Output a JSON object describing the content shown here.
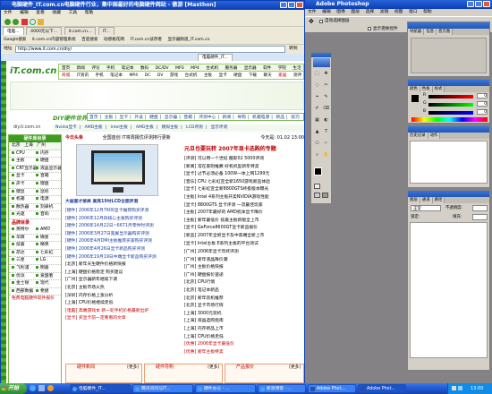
{
  "browser": {
    "title": "电脑硬件_IT.com.cn电脑硬件行业，集中国最好的电脑硬件网站 - 傲游 [Maxthon]",
    "menu": [
      "文件",
      "编辑",
      "查看",
      "收藏",
      "工具",
      "帮助"
    ],
    "tabs": [
      "电脑...",
      "4000元以下...",
      "it.com.cn...",
      "IT..."
    ],
    "links_bar": [
      "Google搜索",
      "it.com.cn内容管理系统",
      "百度搜索",
      "动感桃花网",
      "IT.com.cn读存者",
      "显示器频道_IT.com.cn"
    ],
    "address_label": "地址",
    "address": "http://www.it.com.cn/diy/",
    "go": "转到",
    "page_tabs": [
      "电脑硬件_IT..."
    ]
  },
  "site": {
    "logo": "iT.com.cn",
    "nav_row1": [
      "首页",
      "新闻",
      "评论",
      "手机",
      "笔记本",
      "数码",
      "DC/DV",
      "MP3",
      "MP4",
      "台式机",
      "服务器",
      "显示器",
      "软件",
      "学院",
      "生活",
      "北京",
      "上海",
      "广州",
      "深圳"
    ],
    "nav_row2": [
      "商城",
      "IT资讯",
      "手机",
      "笔记本",
      "MP4",
      "DC",
      "DV",
      "游戏",
      "台式机",
      "主板",
      "显卡",
      "硬盘",
      "下载",
      "聊天",
      "家居",
      "测评",
      "IT生活",
      "游戏",
      "图片",
      "论坛",
      "博客"
    ],
    "section_logo": "DIY硬件世界",
    "section_nav": [
      "首页",
      "主板",
      "显卡",
      "外设",
      "硬盘",
      "显示器",
      "音箱",
      "评测中心",
      "新闻",
      "导购",
      "机箱电源",
      "新品",
      "技巧"
    ],
    "sub_nav": [
      "Nvidia显卡",
      "AMD主板",
      "Intel主板",
      "AMD主板",
      "模拟主板",
      "LCD评测",
      "显示评测"
    ],
    "search_label": "diy.it.com.cn",
    "date_label": "今日头条",
    "date_text": "今天是: 01.02 13:00",
    "headline_top": "全国首创 IT将周报优评测排行更新"
  },
  "sidebar": {
    "title": "硬件库目录",
    "radio_options": [
      "北京",
      "上海",
      "广州"
    ],
    "pairs": [
      [
        "CPU",
        "内存"
      ],
      [
        "主板",
        "硬盘"
      ],
      [
        "CRT显示器",
        "液晶显示器"
      ],
      [
        "显卡",
        "音箱"
      ],
      [
        "声卡",
        "键盘"
      ],
      [
        "键鼠",
        "鼠标"
      ],
      [
        "机箱",
        "电源"
      ],
      [
        "散热器",
        "刻录机"
      ],
      [
        "光驱",
        "音响"
      ]
    ],
    "brand_title": "品牌目录",
    "brands": [
      [
        "英特尔",
        "AMD"
      ],
      [
        "华硕",
        "微星"
      ],
      [
        "技嘉",
        "精英"
      ],
      [
        "昂达",
        "七彩虹"
      ],
      [
        "三星",
        "LG"
      ],
      [
        "飞利浦",
        "明基"
      ],
      [
        "优派",
        "爱国者"
      ],
      [
        "金士顿",
        "现代"
      ],
      [
        "西部数据",
        "希捷"
      ]
    ],
    "footer_link": "免费电脑硬件软件报价"
  },
  "feature": {
    "title": "元旦也要玩转 2007年显卡选购的专题",
    "caption": "大画面才够爽 高亮19吋LCD全面评测",
    "items": [
      "[评测]  可以用一个世纪 酷影02 5000评测",
      "[新闻]  常在家则推薦 好机机型新年特卖",
      "[显卡]  过节必须必备 100W一体上网1299元",
      "[音乐]  CPU 七彩虹宣全新1650游戏新品体验",
      "[显卡]  七彩虹宣全新8800GTS终极版本曝光",
      "[主板]  Intel 4系列主板开卖NVIDIA游戏性能",
      "[显卡]  8800GTS 显卡评测 一流最佳玩家",
      "[主板]  2007年最好的 AMD机体显卡降价",
      "[主板]  新年最低价 技嘉主板新版全上市",
      "[显卡]  GeForce8600GT显卡新品报价",
      "[新品]  2007年全新显卡及中高端全新上市",
      "[显卡]  Intel主板 E系列主板的平台测试"
    ]
  },
  "news_left": [
    "[硬件]  2006年12月7600显卡推荐购买评测",
    "[硬件]  2006年12月四核心主板购买评测",
    "[硬件]  2006年14月22日~6671月零件时评测",
    "[硬件]  2006年3月27日宽屏显示器购买评测",
    "[硬件]  2006年4月DMI主板推荐买家购买评测",
    "[硬件]  2006年4月26日显卡新品购买评测",
    "[硬件]  2006年19月19日中端显卡新品购买评测",
    "[北京]  新年天生硬件价格新快报",
    "[上海]  硬盘价格稳定 购买建议",
    "[广州]  显示器新年继续下调",
    "[北京]  主板市场火热",
    "[深圳]  内存价格上涨分析",
    "[上海]  CPU价格继续走低"
  ],
  "news_left_red": [
    "[电脑]  高端游戏本 新一轮手机价格最新出炉",
    "[显卡]  买显卡前一定要看的文章"
  ],
  "news_right": [
    "[广州]  2006年显卡年终评测",
    "[广州]  新年液晶降价潮",
    "[广州]  主板价格快报",
    "[广州]  硬盘报价速递",
    "[北京]  CPU行情",
    "[北京]  笔记本新品",
    "[北京]  新年装机推荐",
    "[北京]  显卡市场行情",
    "[上海]  3000元装机",
    "[上海]  液晶选购指南",
    "[上海]  内存新品上市",
    "[上海]  CPU价格走低"
  ],
  "news_right_red": [
    "[优惠]  2006年显卡最低价",
    "[优惠]  新年主板特卖"
  ],
  "bottom_boxes": [
    "硬件新闻",
    "硬件导购",
    "产品报价"
  ],
  "more_label": "[更多]",
  "photoshop": {
    "title": "Adobe Photoshop",
    "menu": [
      "文件",
      "编辑",
      "图像",
      "图层",
      "选择",
      "滤镜",
      "视图",
      "窗口",
      "帮助"
    ],
    "options": [
      "自动选择图层",
      "显示变换控件"
    ],
    "nav_panel_tabs": [
      "导航器",
      "信息",
      "直方图"
    ],
    "color_panel_tabs": [
      "颜色",
      "色板",
      "样式"
    ],
    "color_labels": [
      "R",
      "G",
      "B"
    ],
    "color_values": [
      "0",
      "0",
      "0"
    ],
    "history_tabs": [
      "历史记录",
      "动作"
    ],
    "layers_tabs": [
      "图层",
      "通道",
      "路径"
    ],
    "layers_mode": "正常",
    "layers_opacity_label": "不透明度:",
    "layers_lock_label": "锁定:",
    "layers_fill_label": "填充:"
  },
  "taskbar": {
    "start": "开始",
    "buttons": [
      "电脑硬件_IT...",
      "腾讯问问与IT...",
      "硬件办公 - ...",
      "新浪博客 - ...",
      "Adobe Phot...",
      "Adobe Phot..."
    ],
    "clock": "13:00"
  }
}
